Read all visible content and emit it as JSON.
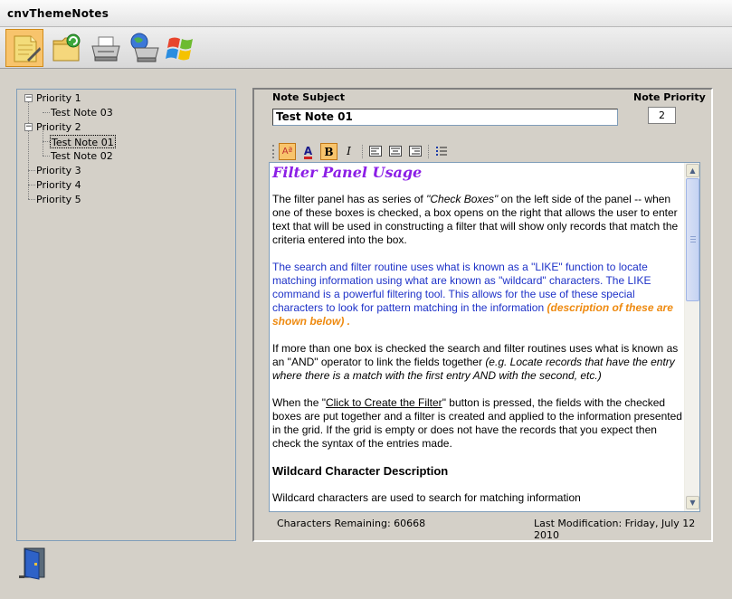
{
  "window": {
    "title": "cnvThemeNotes"
  },
  "toolbar": {
    "buttons": [
      {
        "icon": "notes-folder-icon"
      },
      {
        "icon": "folder-refresh-icon"
      },
      {
        "icon": "printer-icon"
      },
      {
        "icon": "network-printer-icon"
      },
      {
        "icon": "windows-logo-icon"
      }
    ]
  },
  "tree": {
    "nodes": [
      {
        "label": "Priority 1",
        "expander": "−"
      },
      {
        "label": "Test Note 03"
      },
      {
        "label": "Priority 2",
        "expander": "−"
      },
      {
        "label": "Test Note 01",
        "selected": true
      },
      {
        "label": "Test Note 02"
      },
      {
        "label": "Priority 3"
      },
      {
        "label": "Priority 4"
      },
      {
        "label": "Priority 5"
      }
    ]
  },
  "note": {
    "subject_label": "Note Subject",
    "subject_value": "Test Note 01",
    "priority_label": "Note Priority",
    "priority_value": "2"
  },
  "format_toolbar": {
    "buttons": [
      {
        "icon": "font-size-icon",
        "glyph": "Aª",
        "active": true
      },
      {
        "icon": "font-color-icon",
        "glyph": "A"
      },
      {
        "icon": "bold-icon",
        "glyph": "B",
        "active": true
      },
      {
        "icon": "italic-icon",
        "glyph": "I"
      },
      {
        "icon": "align-left-icon"
      },
      {
        "icon": "align-center-icon"
      },
      {
        "icon": "align-right-icon"
      },
      {
        "icon": "bullet-list-icon"
      }
    ]
  },
  "content": {
    "heading": "Filter Panel Usage",
    "p1_a": "The filter panel has as series of ",
    "p1_b": "\"Check Boxes\"",
    "p1_c": "  on the left side of the panel -- when one of these boxes is checked, a box opens on the right that allows the user to enter text that will be used in constructing a filter  that will show only records that match the criteria entered into the box.",
    "p2_a": "The search and filter routine uses what is known as a \"LIKE\" function to locate matching information using what are known as \"wildcard\" characters.  The LIKE command is a powerful filtering tool. This allows for the use of these special characters to look for pattern matching in the information  ",
    "p2_b": "(description of these are shown below)",
    "p2_c": " .",
    "p3_a": "If more than one box is checked the search and filter routines uses what is known as an \"AND\" operator to link the fields together ",
    "p3_b": "(e.g. Locate records that have the entry where there is a match with the first entry AND with the second, etc.)",
    "p4_a": "When  the \"",
    "p4_link": "Click to Create the Filter",
    "p4_b": "\"  button is pressed, the fields with the checked boxes are put together and a filter is created and applied to the information presented in the grid.  If the grid is empty or does not have the records that you expect then check the syntax of the entries made.",
    "heading2": "Wildcard Character Description",
    "p5": "Wildcard characters are used to search for matching information"
  },
  "status": {
    "chars_remaining": "Characters Remaining: 60668",
    "last_mod": "Last Modification:  Friday, July 12 2010"
  },
  "colors": {
    "heading": "#8b1ee6",
    "blue_text": "#1e32c8",
    "orange_text": "#ee8a10",
    "active_button": "#f8c46c"
  },
  "footer": {
    "exit_icon": "exit-door-icon"
  }
}
